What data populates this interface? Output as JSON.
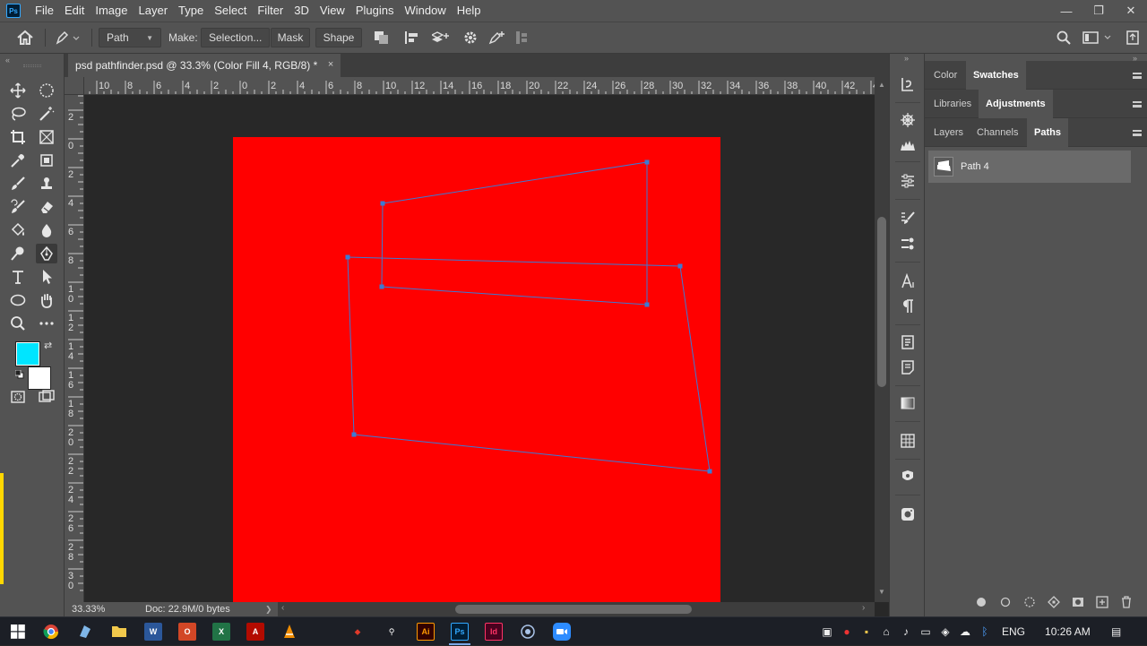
{
  "app": {
    "logo": "Ps"
  },
  "menu": [
    "File",
    "Edit",
    "Image",
    "Layer",
    "Type",
    "Select",
    "Filter",
    "3D",
    "View",
    "Plugins",
    "Window",
    "Help"
  ],
  "window_controls": {
    "minimize": "—",
    "restore": "❐",
    "close": "✕"
  },
  "options": {
    "tool_mode": "Path",
    "make_label": "Make:",
    "selection_button": "Selection...",
    "mask_button": "Mask",
    "shape_button": "Shape"
  },
  "document": {
    "tab_title": "psd pathfinder.psd @ 33.3% (Color Fill 4, RGB/8) *",
    "close": "×",
    "canvas_color": "#ff0000",
    "path_color": "#3a7bd5"
  },
  "rulers": {
    "horizontal": [
      "10",
      "8",
      "6",
      "4",
      "2",
      "0",
      "2",
      "4",
      "6",
      "8",
      "10",
      "12",
      "14",
      "16",
      "18",
      "20",
      "22",
      "24",
      "26",
      "28",
      "30",
      "32",
      "34",
      "36",
      "38",
      "40",
      "42",
      "4"
    ],
    "vertical": [
      "2",
      "0",
      "2",
      "4",
      "6",
      "8",
      "1 0",
      "1 2",
      "1 4",
      "1 6",
      "1 8",
      "2 0",
      "2 2",
      "2 4",
      "2 6",
      "2 8",
      "3 0"
    ]
  },
  "colors": {
    "foreground": "#00e5ff",
    "background": "#ffffff",
    "accent": "#31a8ff"
  },
  "status": {
    "zoom": "33.33%",
    "doc_info": "Doc: 22.9M/0 bytes",
    "arrow": "❯"
  },
  "panels": {
    "group1": {
      "tabs": [
        "Color",
        "Swatches"
      ],
      "active": "Swatches"
    },
    "group2": {
      "tabs": [
        "Libraries",
        "Adjustments"
      ],
      "active": "Adjustments"
    },
    "group3": {
      "tabs": [
        "Layers",
        "Channels",
        "Paths"
      ],
      "active": "Paths"
    },
    "paths": [
      {
        "name": "Path 4"
      }
    ]
  },
  "taskbar": {
    "language": "ENG",
    "time": "10:26 AM",
    "apps": [
      "Windows",
      "Chrome",
      "Files",
      "Explorer",
      "Word",
      "Office",
      "Excel",
      "Acrobat",
      "VLC",
      "PDF",
      "Reader",
      "Ai",
      "Ps",
      "Id",
      "Media",
      "Zoom"
    ]
  }
}
